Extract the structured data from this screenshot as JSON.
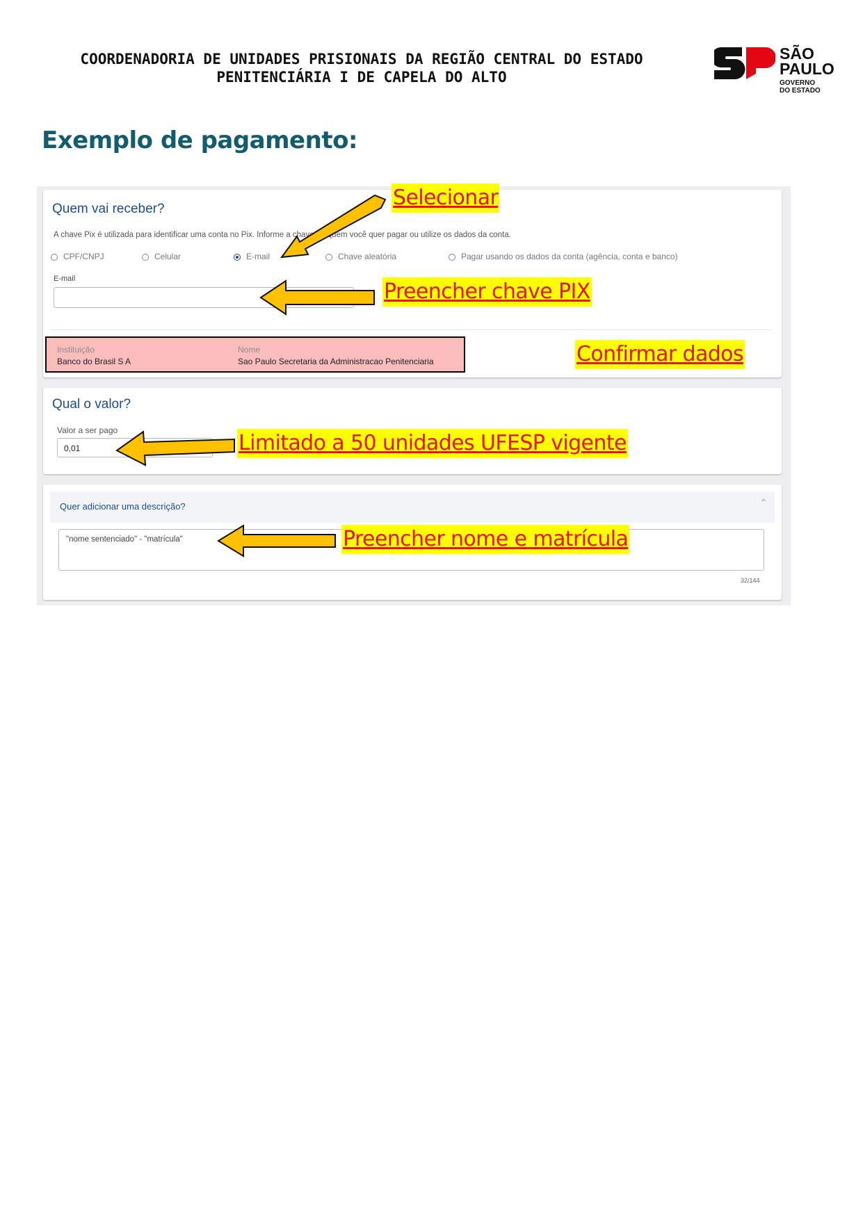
{
  "header": {
    "line1": "COORDENADORIA DE UNIDADES PRISIONAIS DA REGIÃO CENTRAL DO ESTADO",
    "line2": "PENITENCIÁRIA I DE CAPELA DO ALTO"
  },
  "logo": {
    "line1": "SÃO",
    "line2": "PAULO",
    "line3": "GOVERNO",
    "line4": "DO ESTADO"
  },
  "title": "Exemplo de pagamento:",
  "screenshot": {
    "receiver": {
      "heading": "Quem vai receber?",
      "info": "A chave Pix é utilizada para identificar uma conta no Pix. Informe a chave de quem você quer pagar ou utilize os dados da conta.",
      "options": [
        "CPF/CNPJ",
        "Celular",
        "E-mail",
        "Chave aleatória",
        "Pagar usando os dados da conta (agência, conta e banco)"
      ],
      "selected": "E-mail",
      "email_label": "E-mail",
      "email_value": "",
      "institution_label": "Instituição",
      "institution_value": "Banco do Brasil S A",
      "name_label": "Nome",
      "name_value": "Sao Paulo Secretaria da Administracao Penitenciaria"
    },
    "amount": {
      "heading": "Qual o valor?",
      "label": "Valor a ser pago",
      "value": "0,01"
    },
    "description": {
      "heading": "Quer adicionar uma descrição?",
      "value": "\"nome sentenciado\" - \"matrícula\"",
      "counter": "32/144"
    }
  },
  "annotations": {
    "select": "Selecionar",
    "fill_pix": "Preencher chave PIX",
    "confirm": "Confirmar dados",
    "limit": "Limitado a 50 unidades UFESP vigente",
    "fill_name": "Preencher nome e matrícula"
  },
  "colors": {
    "callout_bg": "#ffff00",
    "callout_text": "#e5141e",
    "arrow_fill": "#ffc000",
    "title": "#135c6e",
    "institution_box": "#fbbcbc",
    "logo_red": "#e30613"
  }
}
